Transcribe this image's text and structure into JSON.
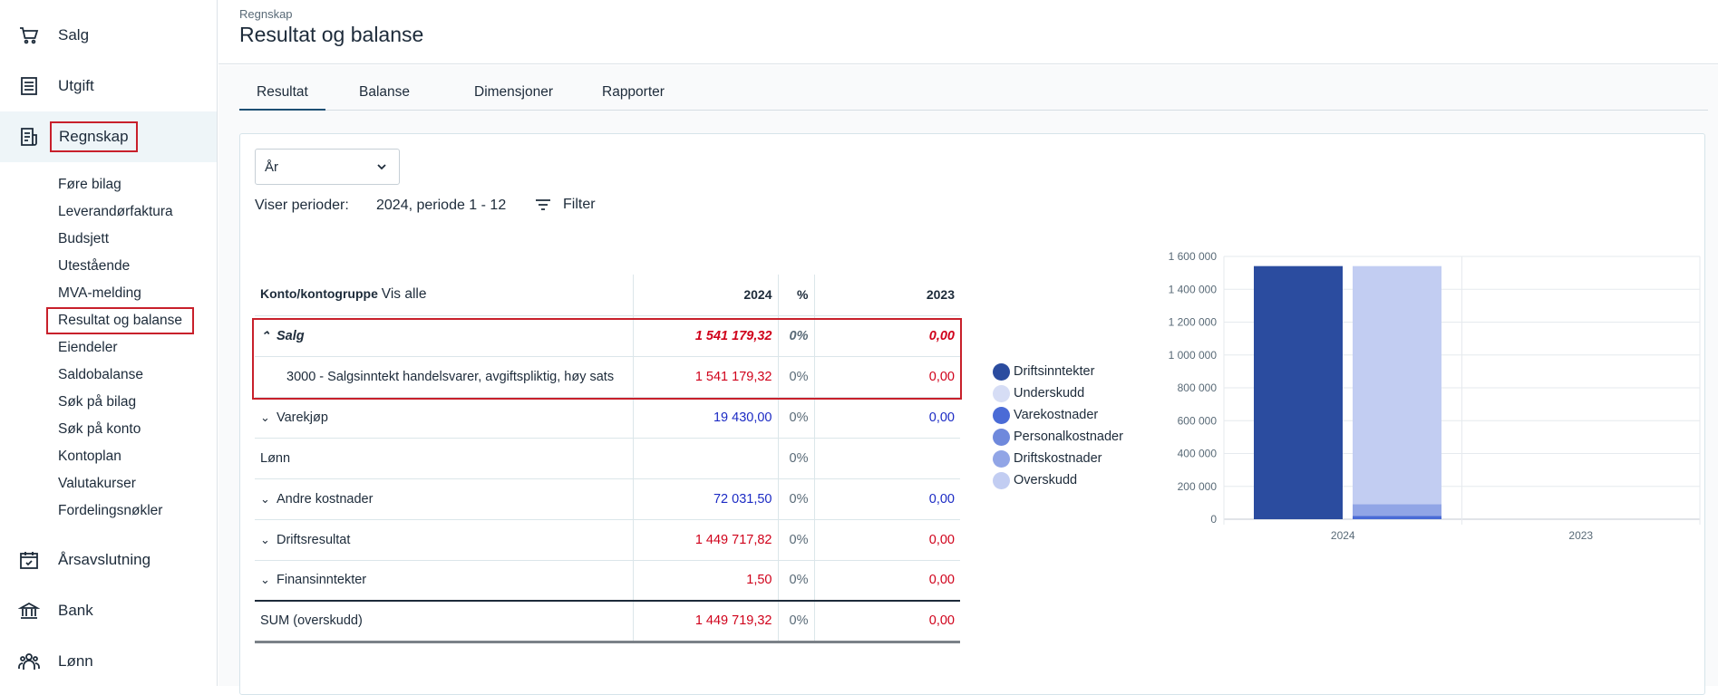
{
  "sidebar": {
    "main_items": [
      {
        "label": "Salg",
        "icon": "cart-icon"
      },
      {
        "label": "Utgift",
        "icon": "list-icon"
      },
      {
        "label": "Regnskap",
        "icon": "ledger-icon"
      },
      {
        "label": "Årsavslutning",
        "icon": "calendar-icon"
      },
      {
        "label": "Bank",
        "icon": "bank-icon"
      },
      {
        "label": "Lønn",
        "icon": "people-icon"
      }
    ],
    "sub_items": [
      "Føre bilag",
      "Leverandørfaktura",
      "Budsjett",
      "Utestående",
      "MVA-melding",
      "Resultat og balanse",
      "Eiendeler",
      "Saldobalanse",
      "Søk på bilag",
      "Søk på konto",
      "Kontoplan",
      "Valutakurser",
      "Fordelingsnøkler"
    ]
  },
  "header": {
    "breadcrumb": "Regnskap",
    "title": "Resultat og balanse"
  },
  "tabs": [
    "Resultat",
    "Balanse",
    "Dimensjoner",
    "Rapporter"
  ],
  "filters": {
    "period_select": "År",
    "periods_label": "Viser perioder:",
    "periods_value": "2024, periode 1 - 12",
    "filter_label": "Filter"
  },
  "table": {
    "header": {
      "name": "Konto/kontogruppe",
      "show_all": "Vis alle",
      "y1": "2024",
      "pct": "%",
      "y2": "2023"
    },
    "rows": [
      {
        "name": "Salg",
        "y1": "1 541 179,32",
        "pct": "0%",
        "y2": "0,00"
      },
      {
        "name": "3000 - Salgsinntekt handelsvarer, avgiftspliktig, høy sats",
        "y1": "1 541 179,32",
        "pct": "0%",
        "y2": "0,00"
      },
      {
        "name": "Varekjøp",
        "y1": "19 430,00",
        "pct": "0%",
        "y2": "0,00"
      },
      {
        "name": "Lønn",
        "y1": "",
        "pct": "0%",
        "y2": ""
      },
      {
        "name": "Andre kostnader",
        "y1": "72 031,50",
        "pct": "0%",
        "y2": "0,00"
      },
      {
        "name": "Driftsresultat",
        "y1": "1 449 717,82",
        "pct": "0%",
        "y2": "0,00"
      },
      {
        "name": "Finansinntekter",
        "y1": "1,50",
        "pct": "0%",
        "y2": "0,00"
      },
      {
        "name": "SUM (overskudd)",
        "y1": "1 449 719,32",
        "pct": "0%",
        "y2": "0,00"
      }
    ]
  },
  "colors": {
    "red": "#d0021b",
    "blue": "#1c2bc4",
    "highlight": "#c8202b"
  },
  "chart_data": {
    "type": "bar",
    "categories": [
      "2024",
      "2023"
    ],
    "ylim": [
      0,
      1600000
    ],
    "y_ticks": [
      "0",
      "200 000",
      "400 000",
      "600 000",
      "800 000",
      "1 000 000",
      "1 200 000",
      "1 400 000",
      "1 600 000"
    ],
    "legend": [
      {
        "name": "Driftsinntekter",
        "color": "#2b4c9f"
      },
      {
        "name": "Underskudd",
        "color": "#d6ddf5"
      },
      {
        "name": "Varekostnader",
        "color": "#4a6bd6"
      },
      {
        "name": "Personalkostnader",
        "color": "#6f89dc"
      },
      {
        "name": "Driftskostnader",
        "color": "#91a5e6"
      },
      {
        "name": "Overskudd",
        "color": "#c2cdf2"
      }
    ],
    "income_bar": {
      "category": "2024",
      "value": 1541179.32,
      "color": "#2b4c9f"
    },
    "cost_stack": {
      "category": "2024",
      "segments": [
        {
          "name": "Varekostnader",
          "value": 19430.0,
          "color": "#4a6bd6"
        },
        {
          "name": "Personalkostnader",
          "value": 0,
          "color": "#6f89dc"
        },
        {
          "name": "Driftskostnader",
          "value": 72031.5,
          "color": "#91a5e6"
        },
        {
          "name": "Overskudd",
          "value": 1449717.82,
          "color": "#c2cdf2"
        }
      ]
    }
  }
}
